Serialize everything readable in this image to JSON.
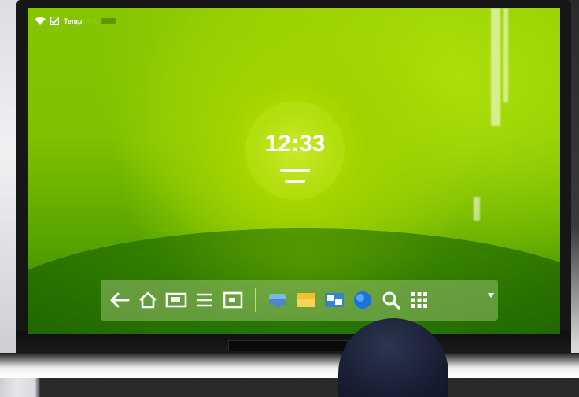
{
  "statusbar": {
    "wifi_icon": "wifi-icon",
    "app_icon": "note-icon",
    "app_label": "Temp",
    "app_label_accent": "13°F"
  },
  "clock": {
    "time": "12:33",
    "bars": [
      "date-line",
      "sub-line"
    ]
  },
  "dock": {
    "nav_buttons": [
      {
        "icon": "back-arrow-icon"
      },
      {
        "icon": "home-icon"
      },
      {
        "icon": "recent-apps-icon"
      },
      {
        "icon": "menu-icon"
      },
      {
        "icon": "screen-icon"
      }
    ],
    "app_buttons": [
      {
        "icon": "storage-icon"
      },
      {
        "icon": "folder-icon"
      },
      {
        "icon": "gallery-icon"
      },
      {
        "icon": "browser-globe-icon"
      },
      {
        "icon": "search-icon"
      },
      {
        "icon": "app-grid-icon"
      }
    ]
  },
  "colors": {
    "screen_green": "#86c400",
    "accent_green": "#7fd600",
    "dock_bg": "#96be6e",
    "bezel": "#161616"
  }
}
